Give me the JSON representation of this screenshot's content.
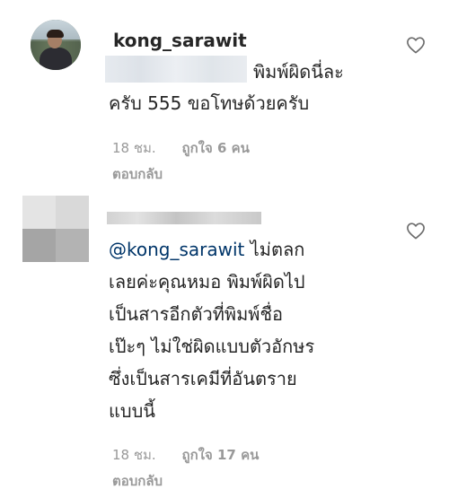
{
  "comments": [
    {
      "username": "kong_sarawit",
      "text_line1": "พิมพ์ผิดนี่ละ",
      "text_line2": "ครับ 555 ขอโทษด้วยครับ",
      "time": "18 ชม.",
      "likes": "ถูกใจ 6 คน",
      "reply": "ตอบกลับ",
      "avatar_icon": "profile-photo-man"
    },
    {
      "mention": "@kong_sarawit",
      "lines": [
        " ไม่ตลก",
        "เลยค่ะคุณหมอ พิมพ์ผิดไป",
        "เป็นสารอีกตัวที่พิมพ์ชื่อ",
        "เป๊ะๆ ไม่ใช่ผิดแบบตัวอักษร",
        "ซึ่งเป็นสารเคมีที่อันตราย",
        "แบบนี้"
      ],
      "time": "18 ชม.",
      "likes": "ถูกใจ 17 คน",
      "reply": "ตอบกลับ",
      "avatar_icon": "pixelated-avatar"
    }
  ],
  "colors": {
    "text": "#262626",
    "meta": "#999999",
    "mention": "#003569"
  },
  "icons": {
    "like": "heart-outline-icon"
  }
}
